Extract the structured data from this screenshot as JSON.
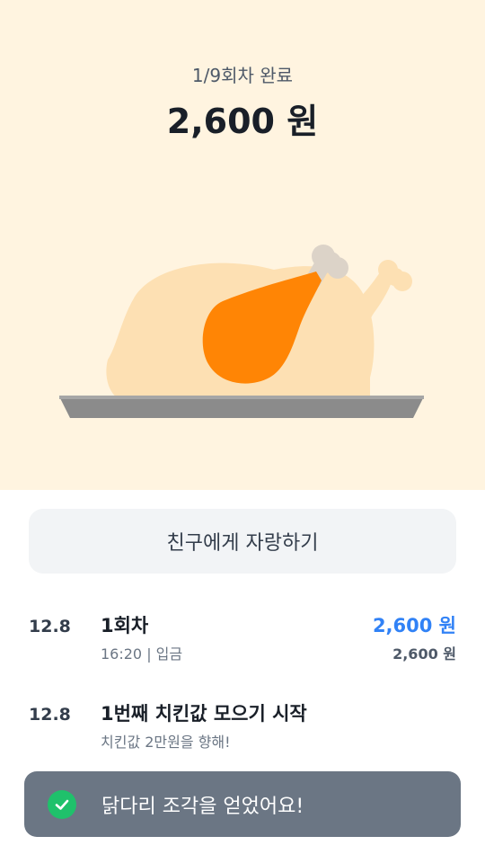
{
  "header": {
    "progress_text": "1/9회차 완료",
    "amount_text": "2,600 원"
  },
  "illustration": {
    "icon": "roast-chicken-with-drumstick-icon",
    "colors": {
      "chicken_body": "#fde0b3",
      "drumstick": "#ff8505",
      "bone": "#dcd3c8",
      "tray": "#8b8b8b"
    }
  },
  "share_button": {
    "label": "친구에게 자랑하기"
  },
  "history": [
    {
      "date": "12.8",
      "title": "1회차",
      "subtitle": "16:20 | 입금",
      "amount": "2,600 원",
      "balance": "2,600 원"
    },
    {
      "date": "12.8",
      "title": "1번째 치킨값 모으기 시작",
      "subtitle": "치킨값 2만원을 향해!"
    }
  ],
  "toast": {
    "icon": "check-circle-icon",
    "message": "닭다리 조각을 얻었어요!"
  },
  "colors": {
    "accent": "#3182f6",
    "hero_background": "#fff4e0",
    "success": "#1fc16b"
  }
}
